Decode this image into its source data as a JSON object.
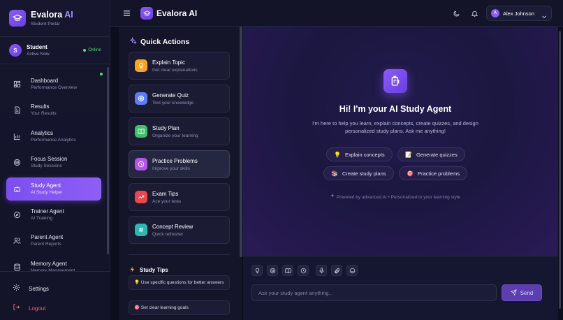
{
  "brand": {
    "name": "Evalora",
    "name_suffix": "AI",
    "subtitle": "Student Portal"
  },
  "sidebar": {
    "user": {
      "initial": "S",
      "name": "Student",
      "status": "Active Now",
      "online_label": "Online"
    },
    "items": [
      {
        "label": "Dashboard",
        "sub": "Performance Overview",
        "icon": "grid-icon"
      },
      {
        "label": "Results",
        "sub": "Your Results",
        "icon": "document-icon"
      },
      {
        "label": "Analytics",
        "sub": "Performance Analytics",
        "icon": "bar-chart-icon"
      },
      {
        "label": "Focus Session",
        "sub": "Study Sessions",
        "icon": "target-icon"
      },
      {
        "label": "Study Agent",
        "sub": "AI Study Helper",
        "icon": "robot-icon",
        "active": true
      },
      {
        "label": "Trainer Agent",
        "sub": "AI Training",
        "icon": "compass-icon"
      },
      {
        "label": "Parent Agent",
        "sub": "Parent Reports",
        "icon": "users-icon"
      },
      {
        "label": "Memory Agent",
        "sub": "Memory Management",
        "icon": "database-icon"
      }
    ],
    "settings_label": "Settings",
    "logout_label": "Logout"
  },
  "topbar": {
    "title": "Evalora AI",
    "user_initial": "A",
    "user_name": "Alex Johnson"
  },
  "quick_actions": {
    "title": "Quick Actions",
    "items": [
      {
        "label": "Explain Topic",
        "sub": "Get clear explanations",
        "color": "#f5a524",
        "icon": "lightbulb-icon"
      },
      {
        "label": "Generate Quiz",
        "sub": "Test your knowledge",
        "color": "#5b7cf5",
        "icon": "target-icon"
      },
      {
        "label": "Study Plan",
        "sub": "Organize your learning",
        "color": "#3fbf6a",
        "icon": "book-icon"
      },
      {
        "label": "Practice Problems",
        "sub": "Improve your skills",
        "color": "#b455e8",
        "icon": "compass-icon"
      },
      {
        "label": "Exam Tips",
        "sub": "Ace your tests",
        "color": "#e8474f",
        "icon": "trend-icon"
      },
      {
        "label": "Concept Review",
        "sub": "Quick refresher",
        "color": "#2cb7b1",
        "icon": "hash-icon"
      }
    ],
    "tips_title": "Study Tips",
    "tips": [
      "💡 Use specific questions for better answers",
      "🎯 Set clear learning goals"
    ]
  },
  "chat": {
    "title": "Hi! I'm your AI Study Agent",
    "description": "I'm here to help you learn, explain concepts, create quizzes, and design personalized study plans. Ask me anything!",
    "chips": [
      {
        "emoji": "💡",
        "label": "Explain concepts"
      },
      {
        "emoji": "📝",
        "label": "Generate quizzes"
      },
      {
        "emoji": "📚",
        "label": "Create study plans"
      },
      {
        "emoji": "🎯",
        "label": "Practice problems"
      }
    ],
    "powered": "Powered by advanced AI • Personalized to your learning style",
    "input_placeholder": "Ask your study agent anything...",
    "send_label": "Send"
  }
}
